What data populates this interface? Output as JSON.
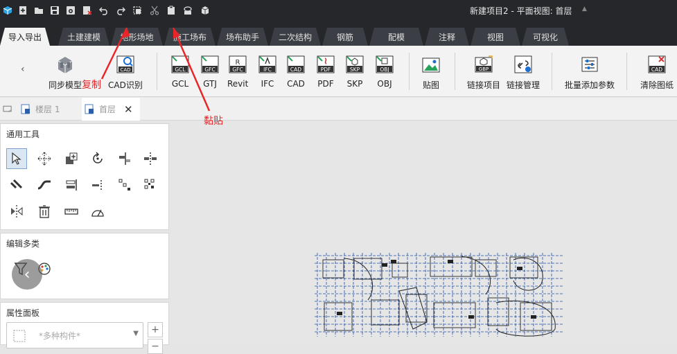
{
  "window": {
    "title": "新建项目2 - 平面视图: 首层"
  },
  "quick_access": [
    "app-logo-icon",
    "new-file-icon",
    "open-folder-icon",
    "save-icon",
    "save-as-icon",
    "close-file-icon",
    "undo-icon",
    "redo-icon",
    "copy-icon",
    "cut-icon",
    "paste-icon",
    "layer-icon",
    "cube-icon"
  ],
  "ribbon_tabs": [
    "导入导出",
    "土建建模",
    "地形场地",
    "施工场布",
    "场布助手",
    "二次结构",
    "钢筋",
    "配模",
    "注释",
    "视图",
    "可视化"
  ],
  "toolbar": {
    "sync_model": "同步模型",
    "cad_recognize": "CAD识别",
    "gcl": "GCL",
    "gtj": "GTJ",
    "revit": "Revit",
    "ifc": "IFC",
    "cad": "CAD",
    "pdf": "PDF",
    "skp": "SKP",
    "obj": "OBJ",
    "paste_image": "贴图",
    "link_project": "链接项目",
    "link_manage": "链接管理",
    "batch_add_params": "批量添加参数",
    "clear_drawing": "清除图纸",
    "icon_texts": {
      "gcl": "GCL",
      "gfc": "GFC",
      "r": "R",
      "ifc": "IFC",
      "cad": "CAD",
      "pdf": "PDF",
      "skp": "SKP",
      "obj": "OBJ",
      "gbp": "GBP"
    }
  },
  "doc_tabs": {
    "floor1": "楼层 1",
    "ground": "首层"
  },
  "panels": {
    "general_tools": "通用工具",
    "edit_multi": "编辑多类",
    "properties": "属性面板",
    "prop_placeholder": "*多种构件*"
  },
  "annotations": {
    "copy": "复制",
    "paste": "黏贴"
  },
  "colors": {
    "dark": "#25272b",
    "accent": "#1a6fd0",
    "annotation": "#e8262a",
    "drawing": "#1f4fa8"
  }
}
